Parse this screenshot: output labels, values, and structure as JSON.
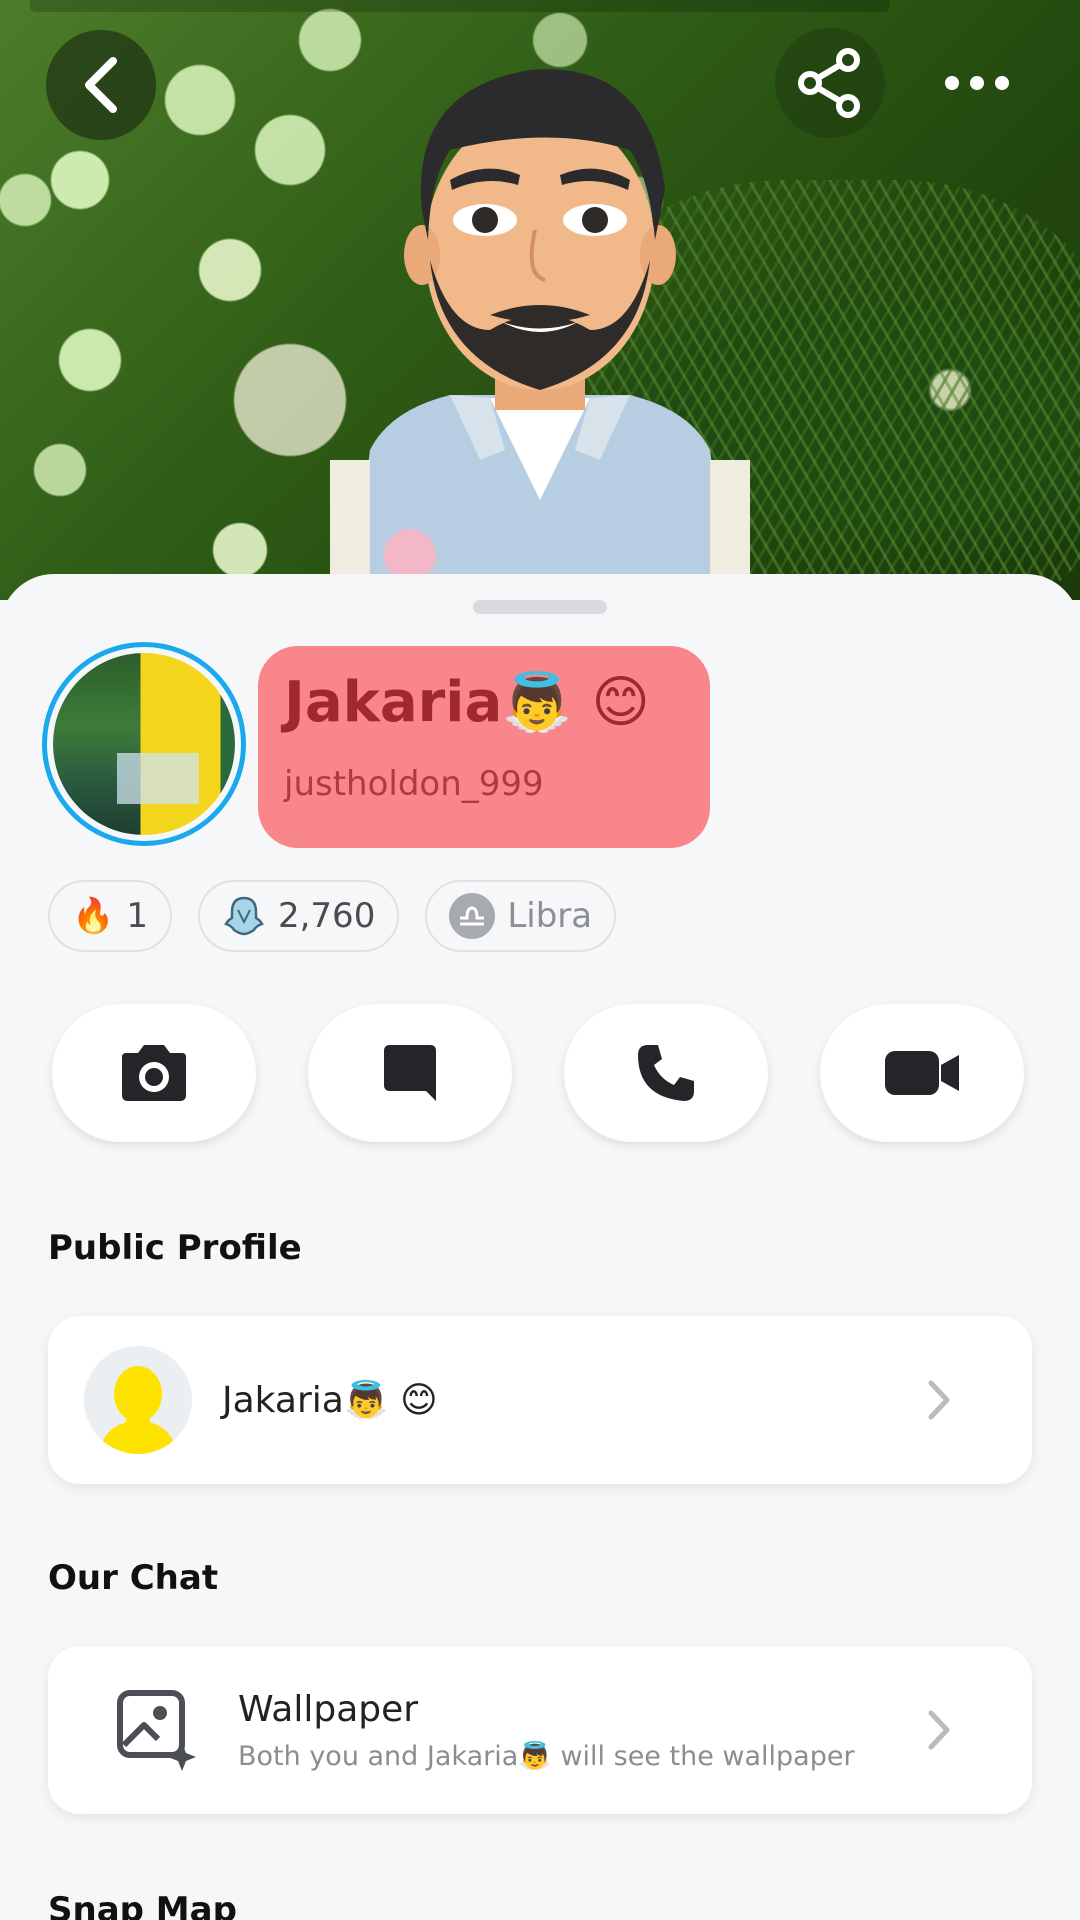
{
  "header": {
    "back_icon": "chevron-left-icon",
    "share_icon": "share-icon",
    "more_icon": "more-horizontal-icon"
  },
  "profile": {
    "display_name": "Jakaria👼 😊",
    "username": "justholdon_999",
    "name_card_color": "#f9868a",
    "ring_color": "#1aa9ee"
  },
  "pills": [
    {
      "icon": "🔥",
      "label": "1"
    },
    {
      "icon": "snap-score-icon",
      "label": "2,760"
    },
    {
      "icon": "libra-icon",
      "label": "Libra"
    }
  ],
  "actions": [
    {
      "name": "camera",
      "icon": "camera-icon"
    },
    {
      "name": "chat",
      "icon": "chat-bubble-icon"
    },
    {
      "name": "call",
      "icon": "phone-icon"
    },
    {
      "name": "video",
      "icon": "video-camera-icon"
    }
  ],
  "public_profile": {
    "section_title": "Public Profile",
    "name": "Jakaria👼 😊"
  },
  "our_chat": {
    "section_title": "Our Chat",
    "wallpaper_title": "Wallpaper",
    "wallpaper_subtitle": "Both you and Jakaria👼 will see the wallpaper"
  },
  "snap_map": {
    "section_title": "Snap Map"
  }
}
